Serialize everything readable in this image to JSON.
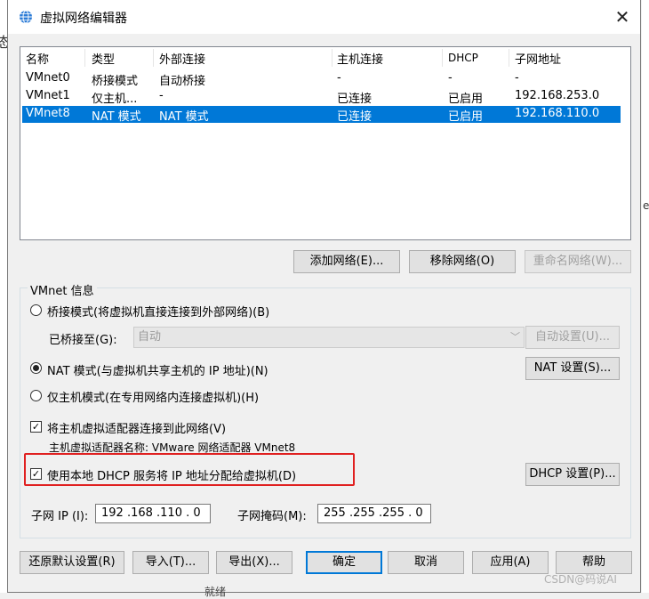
{
  "window": {
    "title": "虚拟网络编辑器",
    "close_glyph": "✕"
  },
  "background": {
    "left_glyph": "态",
    "right_glyph": "er",
    "bottom_text": "就绪"
  },
  "table": {
    "headers": [
      "名称",
      "类型",
      "外部连接",
      "主机连接",
      "DHCP",
      "子网地址"
    ],
    "rows": [
      [
        "VMnet0",
        "桥接模式",
        "自动桥接",
        "-",
        "-",
        "-"
      ],
      [
        "VMnet1",
        "仅主机...",
        "-",
        "已连接",
        "已启用",
        "192.168.253.0"
      ],
      [
        "VMnet8",
        "NAT 模式",
        "NAT 模式",
        "已连接",
        "已启用",
        "192.168.110.0"
      ]
    ],
    "selected_index": 2
  },
  "list_buttons": {
    "add": "添加网络(E)...",
    "remove": "移除网络(O)",
    "rename": "重命名网络(W)..."
  },
  "vmnet_info": {
    "title": "VMnet 信息",
    "bridged_label": "桥接模式(将虚拟机直接连接到外部网络)(B)",
    "bridged_to_label": "已桥接至(G):",
    "bridged_to_value": "自动",
    "auto_settings": "自动设置(U)...",
    "nat_label": "NAT 模式(与虚拟机共享主机的 IP 地址)(N)",
    "nat_settings": "NAT 设置(S)...",
    "hostonly_label": "仅主机模式(在专用网络内连接虚拟机)(H)",
    "connect_adapter_label": "将主机虚拟适配器连接到此网络(V)",
    "adapter_name_label": "主机虚拟适配器名称: VMware 网络适配器 VMnet8",
    "dhcp_label": "使用本地 DHCP 服务将 IP 地址分配给虚拟机(D)",
    "dhcp_settings": "DHCP 设置(P)...",
    "subnet_ip_label": "子网 IP (I):",
    "subnet_ip_value": "192 .168 .110 .  0",
    "subnet_mask_label": "子网掩码(M):",
    "subnet_mask_value": "255 .255 .255 .  0",
    "mode_selected": "nat",
    "connect_adapter_checked": true,
    "dhcp_checked": true
  },
  "footer_buttons": {
    "restore": "还原默认设置(R)",
    "import": "导入(T)...",
    "export": "导出(X)...",
    "ok": "确定",
    "cancel": "取消",
    "apply": "应用(A)",
    "help": "帮助"
  },
  "watermark": "CSDN@码说AI",
  "colors": {
    "selection": "#0078d7",
    "highlight_box": "#e02020"
  },
  "icons": {
    "app": "network-globe-icon",
    "close": "close-icon",
    "dropdown": "chevron-down-icon",
    "check": "checkmark-icon"
  }
}
